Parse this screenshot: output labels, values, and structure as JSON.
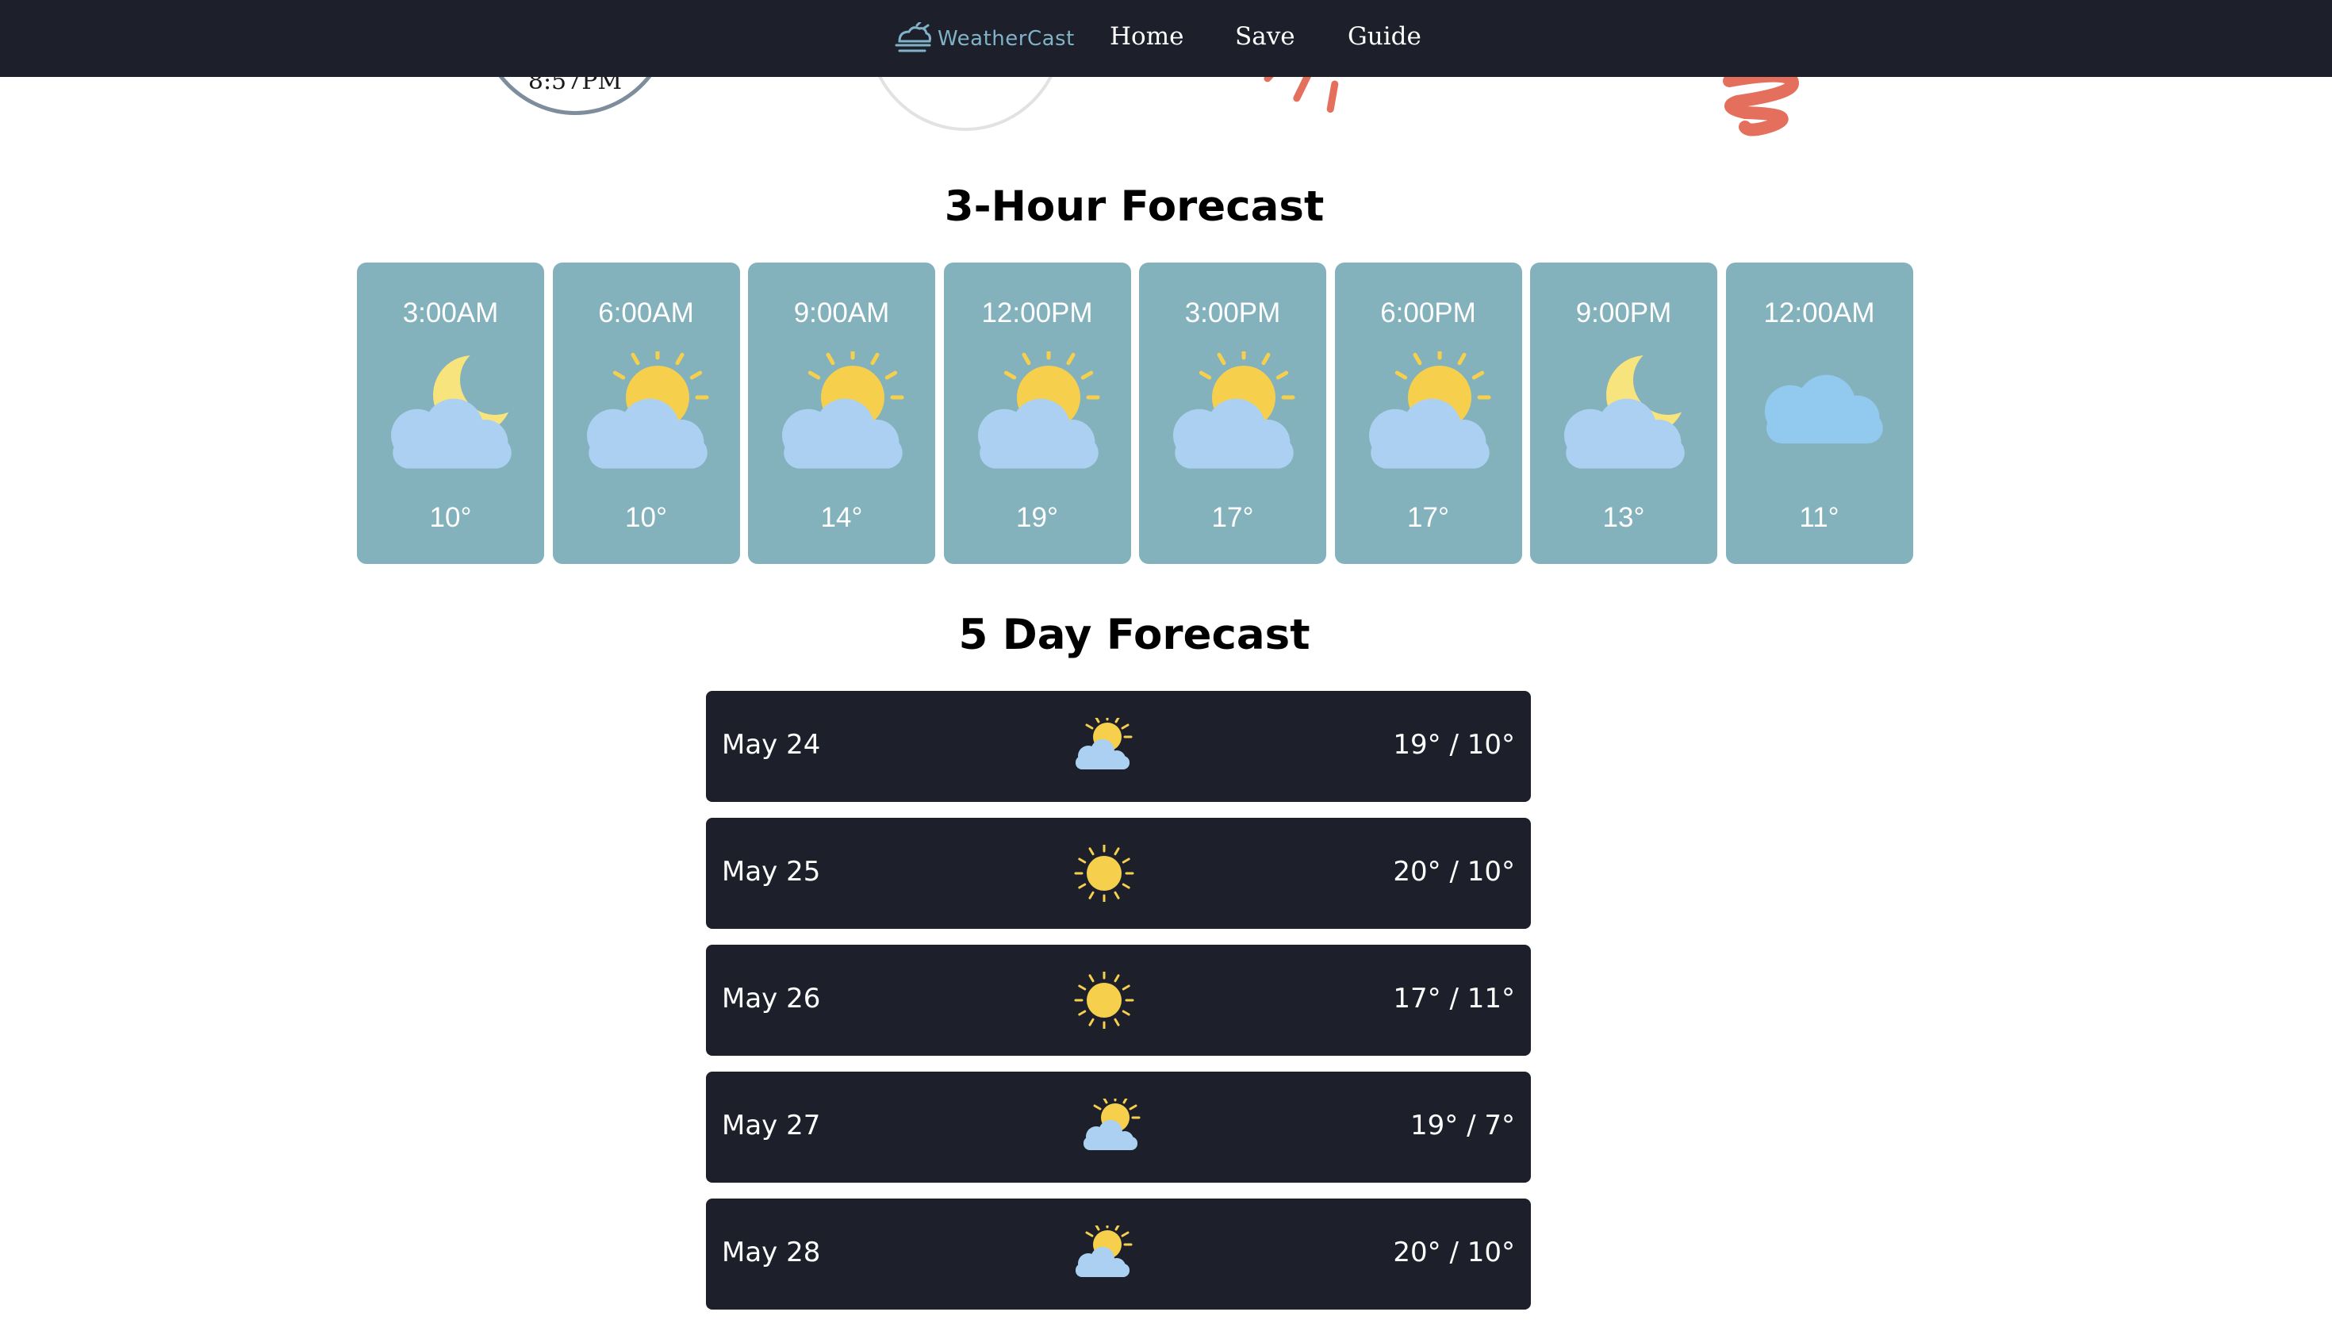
{
  "nav": {
    "brand": "WeatherCast",
    "links": [
      "Home",
      "Save",
      "Guide"
    ]
  },
  "gauges": {
    "clock_time": "8:57PM"
  },
  "hourly": {
    "title": "3-Hour Forecast",
    "items": [
      {
        "time": "3:00AM",
        "temp": "10°",
        "icon": "moon-cloud-icon"
      },
      {
        "time": "6:00AM",
        "temp": "10°",
        "icon": "sun-cloud-icon"
      },
      {
        "time": "9:00AM",
        "temp": "14°",
        "icon": "sun-cloud-icon"
      },
      {
        "time": "12:00PM",
        "temp": "19°",
        "icon": "sun-cloud-icon"
      },
      {
        "time": "3:00PM",
        "temp": "17°",
        "icon": "sun-cloud-icon"
      },
      {
        "time": "6:00PM",
        "temp": "17°",
        "icon": "sun-cloud-icon"
      },
      {
        "time": "9:00PM",
        "temp": "13°",
        "icon": "moon-cloud-icon"
      },
      {
        "time": "12:00AM",
        "temp": "11°",
        "icon": "cloud-icon"
      }
    ]
  },
  "daily": {
    "title": "5 Day Forecast",
    "items": [
      {
        "date": "May 24",
        "temp": "19° / 10°",
        "icon": "partly-cloudy-icon"
      },
      {
        "date": "May 25",
        "temp": "20° / 10°",
        "icon": "sun-icon"
      },
      {
        "date": "May 26",
        "temp": "17° / 11°",
        "icon": "sun-icon"
      },
      {
        "date": "May 27",
        "temp": "19° / 7°",
        "icon": "partly-cloudy-icon"
      },
      {
        "date": "May 28",
        "temp": "20° / 10°",
        "icon": "partly-cloudy-icon"
      }
    ]
  },
  "colors": {
    "nav_bg": "#1d1f2a",
    "card_bg": "#83b2bc",
    "brand": "#80b3c7",
    "sun": "#f6d04d",
    "moon": "#f8e47c",
    "cloud": "#acd0f1"
  }
}
